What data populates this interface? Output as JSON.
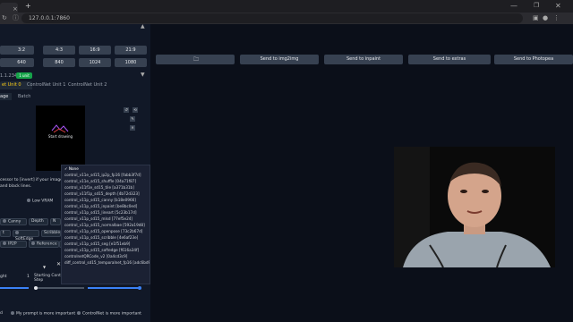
{
  "browser": {
    "tab_close": "×",
    "new_tab": "+",
    "url": "127.0.0.1:7860",
    "reload_glyph": "↻",
    "info_glyph": "ⓘ",
    "window_buttons": [
      "—",
      "❐",
      "✕"
    ]
  },
  "left_panel": {
    "ratios": [
      "3:2",
      "4:3",
      "16:9",
      "21:9"
    ],
    "sizes": [
      "640",
      "840",
      "1024",
      "1080"
    ],
    "version": "1.1.234",
    "badge": "1 unit",
    "controlnet_tabs": [
      "et Unit 0",
      "ControlNet Unit 1",
      "ControlNet Unit 2"
    ],
    "sub_tabs": [
      "age",
      "Batch"
    ],
    "canvas_text": "Start drawing",
    "canvas_tools": [
      "↺",
      "⟲",
      "✎",
      "✕"
    ],
    "preprocessor_note_1": "cessor to [invert] if your image ha",
    "preprocessor_note_2": "and black lines.",
    "low_vram": "Low VRAM",
    "pixel_perfect": "Pixel Pe",
    "preprocessors_row1": [
      "Canny",
      "Depth",
      "N"
    ],
    "preprocessors_row2": [
      "t",
      "SoftEdge",
      "Scribble"
    ],
    "preprocessors_row3": [
      "IP2P",
      "Reference",
      "R"
    ],
    "sliders": {
      "weight_label": "ght",
      "weight_value": "1",
      "start_label_1": "Starting Control",
      "start_label_2": "Step",
      "start_value": "0",
      "end_label_1": "Ending Control",
      "end_label_2": "Step",
      "end_value": "1"
    },
    "control_modes": [
      "d",
      "My prompt is more important",
      "ControlNet is more important"
    ]
  },
  "dropdown": {
    "items": [
      "✓ None",
      "control_v11e_sd15_ip2p_fp16 [fabb3f7d]",
      "control_v11e_sd15_shuffle [04a71f87]",
      "control_v11f1e_sd15_tile [a371b31b]",
      "control_v11f1p_sd15_depth [4b72d323]",
      "control_v11p_sd15_canny [b18e0966]",
      "control_v11p_sd15_inpaint [be8bc0ed]",
      "control_v11p_sd15_lineart [5c23b17d]",
      "control_v11p_sd15_mlsd [77ef5e24]",
      "control_v11p_sd15_normalbae [592a19d8]",
      "control_v11p_sd15_openpose [73c2b67d]",
      "control_v11p_sd15_scribble [4e6af23e]",
      "control_v11p_sd15_seg [e1f51eb9]",
      "control_v11p_sd15_softedge [f616a34f]",
      "controlnetQRCode_v2 [0a4cd3c9]",
      "diff_control_sd15_temporalnet_fp16 [adc6bd97]"
    ]
  },
  "output_panel": {
    "folder_glyph": "🗀",
    "send_buttons": [
      "Send to img2img",
      "Send to inpaint",
      "Send to extras",
      "Send to Photopea"
    ]
  },
  "colors": {
    "accent": "#3b82f6",
    "badge": "#16a34a",
    "active_tab": "#facc15"
  }
}
